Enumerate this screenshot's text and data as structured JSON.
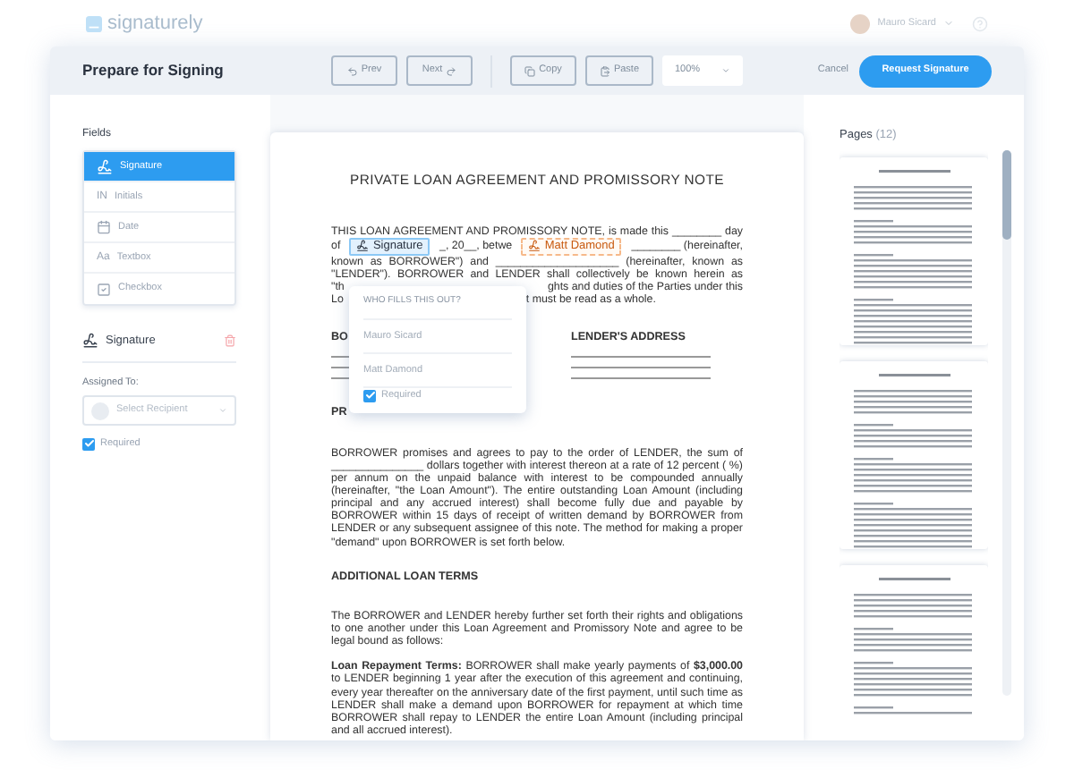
{
  "app": {
    "logo": "signaturely",
    "user": "Mauro Sicard"
  },
  "toolbar": {
    "title": "Prepare for Signing",
    "prev": "Prev",
    "next": "Next",
    "copy": "Copy",
    "paste": "Paste",
    "zoom": "100%",
    "cancel": "Cancel",
    "request": "Request Signature"
  },
  "fields": {
    "heading": "Fields",
    "items": [
      {
        "kind": "signature",
        "label": "Signature",
        "selected": true
      },
      {
        "kind": "initials",
        "glyph": "IN",
        "label": "Initials",
        "selected": false
      },
      {
        "kind": "date",
        "label": "Date",
        "selected": false
      },
      {
        "kind": "textbox",
        "glyph": "Aa",
        "label": "Textbox",
        "selected": false
      },
      {
        "kind": "checkbox",
        "label": "Checkbox",
        "selected": false
      }
    ]
  },
  "selected_field": {
    "label": "Signature",
    "assigned_label": "Assigned To:",
    "recipient_placeholder": "Select Recipient",
    "required_label": "Required",
    "required": true
  },
  "document": {
    "title": "PRIVATE LOAN AGREEMENT AND PROMISSORY NOTE",
    "intro_lines": [
      {
        "parts": [
          {
            "kind": "text",
            "text": "THIS LOAN AGREEMENT AND PROMISSORY NOTE, is made this ________ day"
          }
        ]
      },
      {
        "parts": [
          {
            "kind": "text",
            "text": "of"
          },
          {
            "kind": "signature_tag",
            "text": "Signature"
          },
          {
            "kind": "text",
            "text": "_, 20__, betwe"
          },
          {
            "kind": "recipient_tag",
            "text": "Matt Damond"
          },
          {
            "kind": "text",
            "text": "________ (hereinafter,"
          }
        ]
      },
      {
        "parts": [
          {
            "kind": "text",
            "text": "known as BORROWER\") and ____________________ (hereinafter, known as"
          }
        ]
      },
      {
        "parts": [
          {
            "kind": "text",
            "text": "\"LENDER\"). BORROWER and LENDER shall collectively be known herein as"
          }
        ]
      },
      {
        "parts": [
          {
            "kind": "text",
            "text": "\"th"
          },
          {
            "kind": "text",
            "text": "ghts and duties of the Parties under this"
          }
        ]
      },
      {
        "parts": [
          {
            "kind": "text",
            "text": "Lo"
          },
          {
            "kind": "tail",
            "text": "t must be read as a whole."
          }
        ]
      }
    ],
    "address_left": "BO",
    "address_right": "LENDER'S ADDRESS",
    "note_heading": "PR",
    "paragraph_1": "BORROWER promises and agrees to pay to the order of LENDER, the sum of _______________ dollars together with interest thereon at a rate of 12 percent ( %) per annum on the unpaid balance with interest to be compounded annually (hereinafter, \"the Loan Amount\"). The entire outstanding Loan Amount (including principal and any accrued interest) shall become fully due and payable by BORROWER within 15 days of receipt of written demand by BORROWER from LENDER or any subsequent assignee of this note. The method for making a proper \"demand\" upon BORROWER is set forth below.",
    "terms_heading": "ADDITIONAL LOAN TERMS",
    "paragraph_2": "The BORROWER and LENDER hereby further set forth their rights and obligations to one another under this Loan Agreement and Promissory Note and agree to be legal bound as follows:",
    "paragraph_3": "**Loan Repayment Terms:** BORROWER shall make yearly payments of **$3,000.00** to LENDER beginning 1 year after the execution of this agreement and continuing, every year thereafter on the anniversary date of the first payment, until such time as LENDER shall make a demand upon BORROWER for repayment at which time BORROWER shall repay to LENDER the entire Loan Amount (including principal and all accrued interest).",
    "popup": {
      "heading": "WHO FILLS THIS OUT?",
      "options": [
        "Mauro Sicard",
        "Matt Damond"
      ],
      "required_label": "Required",
      "required": true
    }
  },
  "pages": {
    "heading": "Pages",
    "count": "(12)"
  }
}
